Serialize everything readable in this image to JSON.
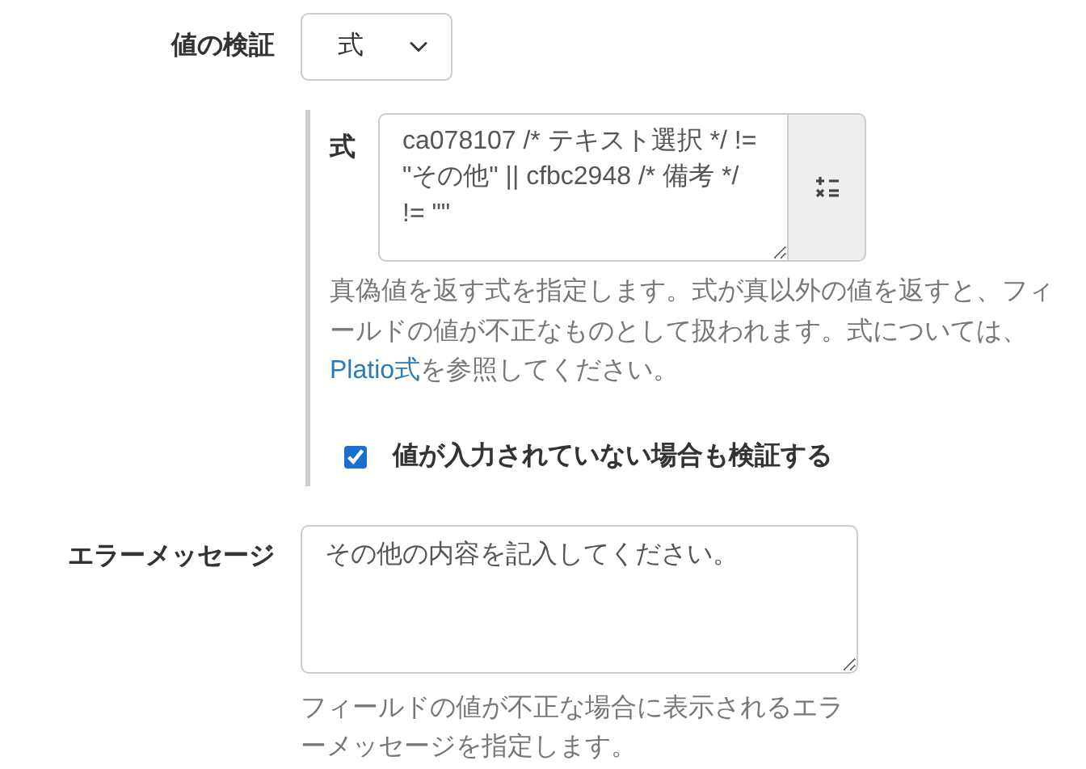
{
  "validation": {
    "label": "値の検証",
    "select_value": "式"
  },
  "expression": {
    "label": "式",
    "value": "ca078107 /* テキスト選択 */ != \"その他\" || cfbc2948 /* 備考 */ != \"\"",
    "help_before": "真偽値を返す式を指定します。式が真以外の値を返すと、フィールドの値が不正なものとして扱われます。式については、",
    "help_link": "Platio式",
    "help_after": "を参照してください。"
  },
  "validate_empty": {
    "label": "値が入力されていない場合も検証する",
    "checked": true
  },
  "error_message": {
    "label": "エラーメッセージ",
    "value": "その他の内容を記入してください。",
    "help": "フィールドの値が不正な場合に表示されるエラーメッセージを指定します。"
  }
}
